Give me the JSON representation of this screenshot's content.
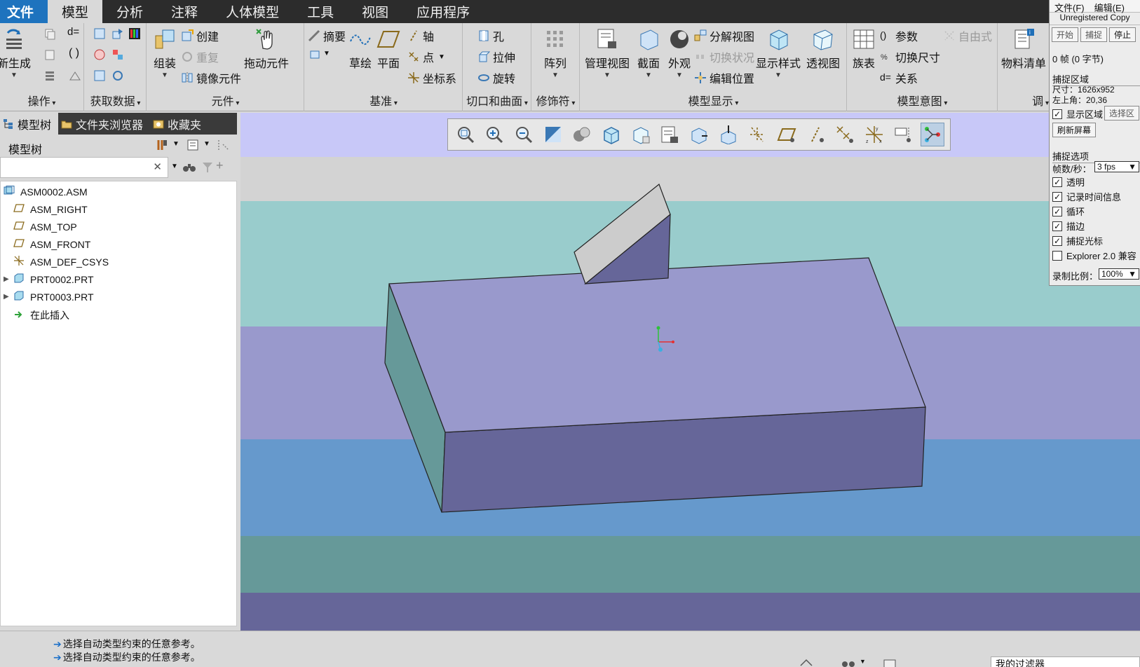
{
  "menubar": {
    "items": [
      "文件",
      "模型",
      "分析",
      "注释",
      "人体模型",
      "工具",
      "视图",
      "应用程序"
    ],
    "active_index": 1
  },
  "ribbon": {
    "groups": {
      "operations": {
        "title": "操作",
        "regenerate": "新生成"
      },
      "get_data": {
        "title": "获取数据"
      },
      "component": {
        "title": "元件",
        "assemble": "组装",
        "create": "创建",
        "repeat": "重复",
        "mirror": "镜像元件",
        "drag": "拖动元件"
      },
      "datum": {
        "title": "基准",
        "summary": "摘要",
        "sketch": "草绘",
        "plane": "平面",
        "axis": "轴",
        "point": "点",
        "csys": "坐标系"
      },
      "cut_surface": {
        "title": "切口和曲面",
        "hole": "孔",
        "extrude": "拉伸",
        "revolve": "旋转"
      },
      "modifier": {
        "title": "修饰符",
        "pattern": "阵列"
      },
      "model_display": {
        "title": "模型显示",
        "manage_views": "管理视图",
        "section": "截面",
        "appearance": "外观",
        "explode": "分解视图",
        "toggle_state": "切换状况",
        "edit_position": "编辑位置",
        "display_style": "显示样式",
        "perspective": "透视图"
      },
      "model_intent": {
        "title": "模型意图",
        "family_table": "族表",
        "parameters": "参数",
        "switch_dims": "切换尺寸",
        "relations": "关系",
        "freestyle": "自由式"
      },
      "bom": {
        "title": "调",
        "bom": "物料清单"
      }
    }
  },
  "left_panel": {
    "tabs": [
      "模型树",
      "文件夹浏览器",
      "收藏夹"
    ],
    "tree_title": "模型树",
    "search_value": "",
    "tree_items": [
      {
        "label": "ASM0002.ASM",
        "icon": "assembly-icon",
        "expandable": false
      },
      {
        "label": "ASM_RIGHT",
        "icon": "datum-plane-icon",
        "expandable": false
      },
      {
        "label": "ASM_TOP",
        "icon": "datum-plane-icon",
        "expandable": false
      },
      {
        "label": "ASM_FRONT",
        "icon": "datum-plane-icon",
        "expandable": false
      },
      {
        "label": "ASM_DEF_CSYS",
        "icon": "csys-icon",
        "expandable": false
      },
      {
        "label": "PRT0002.PRT",
        "icon": "part-icon",
        "expandable": true
      },
      {
        "label": "PRT0003.PRT",
        "icon": "part-icon",
        "expandable": true
      },
      {
        "label": "在此插入",
        "icon": "insert-here-icon",
        "expandable": false
      }
    ]
  },
  "viewport": {
    "background_bands": [
      "#c8c8f8",
      "#d3d3d3",
      "#99cccc",
      "#9999cc",
      "#6699cc",
      "#669999",
      "#666699"
    ],
    "block_colors": {
      "top": "#9999cc",
      "front": "#666699",
      "left": "#669999"
    },
    "wedge_colors": {
      "top": "#cccccc",
      "side": "#666699"
    }
  },
  "statusbar": {
    "messages": [
      "选择自动类型约束的任意参考。",
      "选择自动类型约束的任意参考。"
    ],
    "filter_value": "我的过滤器"
  },
  "capture": {
    "menu": [
      "文件(F)",
      "编辑(E)"
    ],
    "title": "Unregistered Copy",
    "buttons": [
      "开始",
      "捕捉",
      "停止"
    ],
    "frames": "0 帧 (0 字节)",
    "region_section": "捕捉区域",
    "size": "尺寸：1626x952",
    "top_left": "左上角：20,36",
    "show_region": "显示区域",
    "select_region": "选择区",
    "refresh": "刷新屏幕",
    "options_section": "捕捉选项",
    "fps_label": "帧数/秒：",
    "fps_value": "3 fps",
    "options": [
      {
        "label": "透明",
        "checked": true
      },
      {
        "label": "记录时间信息",
        "checked": true
      },
      {
        "label": "循环",
        "checked": true
      },
      {
        "label": "描边",
        "checked": true
      },
      {
        "label": "捕捉光标",
        "checked": true
      },
      {
        "label": "Explorer 2.0 兼容",
        "checked": false
      }
    ],
    "scale_label": "录制比例：",
    "scale_value": "100%"
  }
}
